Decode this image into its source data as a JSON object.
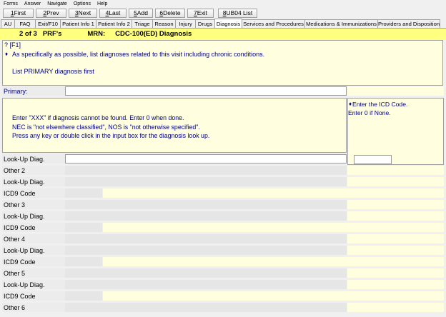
{
  "menu": [
    "Forms",
    "Answer",
    "Navigate",
    "Options",
    "Help"
  ],
  "toolbar": {
    "first": {
      "key": "1",
      "label": " First"
    },
    "prev": {
      "key": "2",
      "label": " Prev"
    },
    "next": {
      "key": "3",
      "label": " Next"
    },
    "last": {
      "key": "4",
      "label": " Last"
    },
    "add": {
      "key": "5",
      "label": " Add"
    },
    "delete": {
      "key": "6",
      "label": " Delete"
    },
    "exit": {
      "key": "7",
      "label": " Exit"
    },
    "ub04": {
      "key": "8",
      "label": " UB04 List"
    }
  },
  "tabs": [
    "AU",
    "FAQ",
    "Exit/F10",
    "Patient Info 1",
    "Patient Info 2",
    "Triage",
    "Reason",
    "Injury",
    "Drugs",
    "Diagnosis",
    "Services and Procedures",
    "Medications & Immunizations",
    "Providers and Disposition"
  ],
  "active_tab": "Diagnosis",
  "header": {
    "record": "2 of 3",
    "form": "PRF's",
    "mrn_label": "MRN:",
    "mrn_value": "CDC-100(ED) Diagnosis"
  },
  "instructions": {
    "qid": "? [F1]",
    "bullet": "♦",
    "line1": "As specifically as possible, list diagnoses related to this visit including chronic conditions.",
    "line2": "List PRIMARY diagnosis first"
  },
  "primary_label": "Primary:",
  "help": {
    "line1": "Enter \"XXX\" if diagnosis cannot be found. Enter 0 when done.",
    "line2": "NEC is \"not elsewhere classified\", NOS is \"not otherwise specified\".",
    "line3": "Press any key or double click in the input box for the diagnosis look up."
  },
  "icd_help": {
    "bullet": "♦",
    "line1": "Enter the ICD Code.",
    "line2": "Enter 0 if None."
  },
  "rows": {
    "lookup1": "Look-Up Diag.",
    "other2": "Other 2",
    "lookup2": "Look-Up Diag.",
    "icd2": "ICD9 Code",
    "other3": "Other 3",
    "lookup3": "Look-Up Diag.",
    "icd3": "ICD9 Code",
    "other4": "Other 4",
    "lookup4": "Look-Up Diag.",
    "icd4": "ICD9 Code",
    "other5": "Other 5",
    "lookup5": "Look-Up Diag.",
    "icd5": "ICD9 Code",
    "other6": "Other 6"
  },
  "colors": {
    "header_yellow": "#ffff80",
    "panel_yellow": "#ffffe0",
    "text_blue": "#000080"
  }
}
